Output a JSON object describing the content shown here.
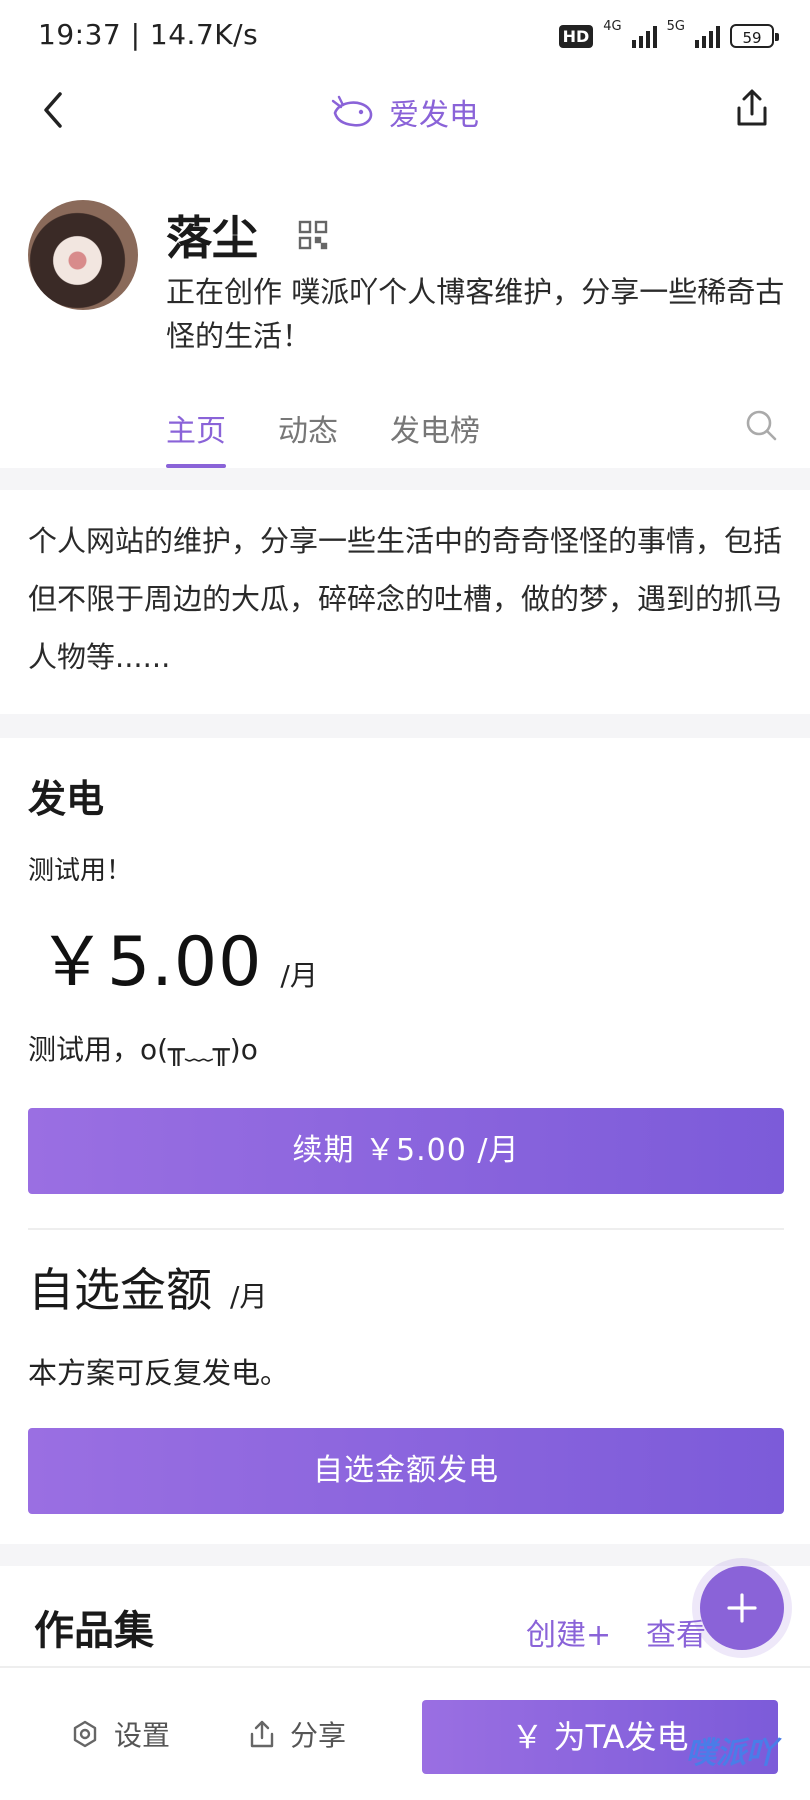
{
  "status_bar": {
    "time": "19:37 | 14.7K/s",
    "hd_label": "HD",
    "net1": "4G",
    "net2": "5G",
    "battery": "59"
  },
  "nav": {
    "title": "爱发电"
  },
  "profile": {
    "name": "落尘",
    "bio": "正在创作 噗派吖个人博客维护，分享一些稀奇古怪的生活！",
    "tabs": [
      "主页",
      "动态",
      "发电榜"
    ]
  },
  "about": {
    "text": "个人网站的维护，分享一些生活中的奇奇怪怪的事情，包括但不限于周边的大瓜，碎碎念的吐槽，做的梦，遇到的抓马人物等......"
  },
  "charge": {
    "title": "发电",
    "plan_name": "测试用！",
    "price": "￥5.00",
    "per": "/月",
    "plan_desc": "测试用，o(╥﹏╥)o",
    "renew_button": "续期 ￥5.00 /月",
    "custom_title": "自选金额",
    "custom_per": "/月",
    "custom_desc": "本方案可反复发电。",
    "custom_button": "自选金额发电"
  },
  "works": {
    "title": "作品集",
    "create": "创建+",
    "view_all": "查看"
  },
  "bottom": {
    "settings": "设置",
    "share": "分享",
    "support_button": "￥ 为TA发电",
    "watermark": "噗派吖"
  },
  "colors": {
    "accent": "#8a63d8",
    "button_gradient_start": "#9a6fe2",
    "button_gradient_end": "#7c5bd9"
  }
}
